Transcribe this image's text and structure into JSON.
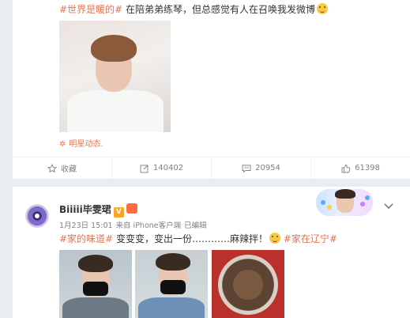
{
  "post1": {
    "tag_world": "#世界是暖的#",
    "text": " 在陪弟弟练琴，但总感觉有人在召唤我发微博",
    "emoji_icon": "grin-emoji-icon",
    "source": "明星动态.",
    "actions": {
      "collect_label": "收藏",
      "forward_count": "140402",
      "comment_count": "20954",
      "like_count": "61398"
    }
  },
  "post2": {
    "username": "Biiiii毕雯珺",
    "verified_badge": "V",
    "timestamp": "1月23日 15:01",
    "via": "来自 iPhone客户端",
    "edited": "已编辑",
    "tag_home_taste": "#家的味道#",
    "text_mid": " 变变变，变出一份…………麻辣拌！",
    "tag_home_liaoning": "#家在辽宁#"
  },
  "colors": {
    "accent": "#eb7350",
    "gray_text": "#808080",
    "background": "#e9ecf1"
  }
}
